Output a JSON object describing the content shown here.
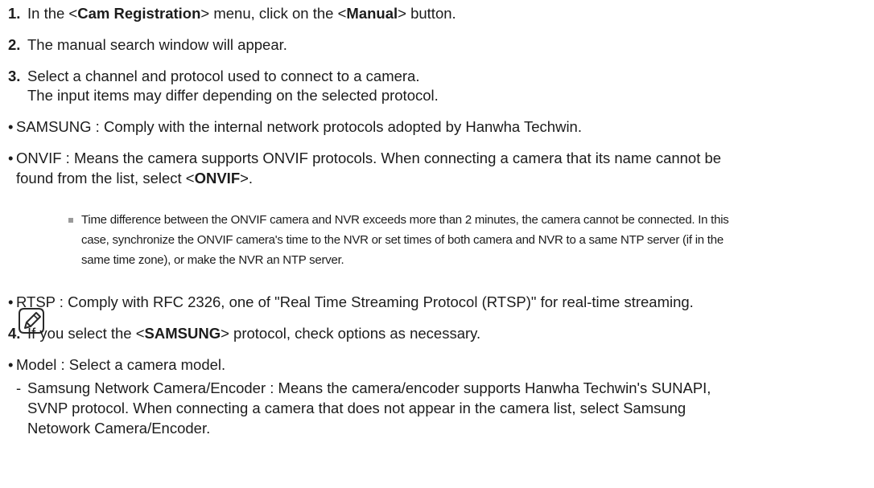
{
  "steps": [
    {
      "num": "1.",
      "pre": "In the <",
      "b1": "Cam Registration",
      "mid": "> menu, click on the <",
      "b2": "Manual",
      "post": "> button."
    },
    {
      "num": "2.",
      "text": "The manual search window will appear."
    },
    {
      "num": "3.",
      "line1": "Select a channel and protocol used to connect to a camera.",
      "line2": "The input items may differ depending on the selected protocol."
    },
    {
      "num": "4.",
      "pre": "If you select the <",
      "b": "SAMSUNG",
      "post": "> protocol, check options as necessary."
    }
  ],
  "bullets": {
    "samsung": "SAMSUNG : Comply with the internal network protocols adopted by Hanwha Techwin.",
    "onvif_line1": "ONVIF : Means the camera supports ONVIF protocols. When connecting a camera that its name cannot be",
    "onvif_line2_pre": "found from the list, select <",
    "onvif_line2_b": "ONVIF",
    "onvif_line2_post": ">.",
    "rtsp": "RTSP : Comply with RFC 2326, one of \"Real Time Streaming Protocol (RTSP)\" for real-time streaming.",
    "model": "Model : Select a camera model."
  },
  "note": {
    "icon": "note-pencil-icon",
    "line1": "Time difference between the ONVIF camera and NVR exceeds more than 2 minutes, the camera cannot be connected. In this",
    "line2": "case, synchronize the ONVIF camera's time to the NVR or set times of both camera and NVR to a same NTP server (if in the",
    "line3": "same time zone), or make the NVR an NTP server."
  },
  "sub_item": {
    "line1": "Samsung Network Camera/Encoder : Means the camera/encoder supports Hanwha Techwin's SUNAPI,",
    "line2": "SVNP protocol. When connecting a camera that does not appear in the camera list, select Samsung",
    "line3": "Netowork Camera/Encoder."
  },
  "symbols": {
    "bullet": "•",
    "dash": "-"
  }
}
